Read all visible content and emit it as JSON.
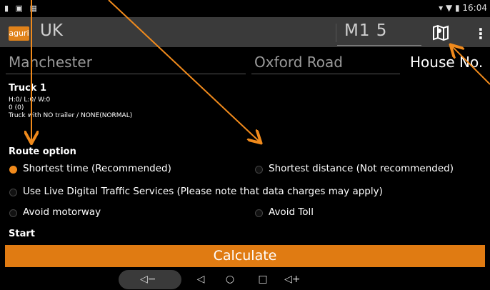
{
  "status": {
    "left_icons": "▮ ▣ ▦",
    "right": "▾ ▼ ▮ 16:04"
  },
  "topbar": {
    "logo": "aguri",
    "country": "UK",
    "postcode": "M1 5"
  },
  "address": {
    "city": "Manchester",
    "street": "Oxford Road",
    "house": "House No."
  },
  "truck": {
    "title": "Truck 1",
    "lines": [
      "H:0/ L:0/ W:0",
      "0 (0)",
      "Truck with NO trailer / NONE(NORMAL)"
    ]
  },
  "route": {
    "title": "Route option",
    "options": [
      {
        "label": "Shortest time (Recommended)",
        "selected": true
      },
      {
        "label": "Shortest distance (Not recommended)",
        "selected": false
      },
      {
        "label": "Use Live Digital Traffic Services (Please note that data charges may apply)",
        "selected": false
      },
      {
        "label": "Avoid motorway",
        "selected": false
      },
      {
        "label": "Avoid Toll",
        "selected": false
      }
    ]
  },
  "start_label": "Start",
  "calculate_label": "Calculate",
  "nav": {
    "vol_down": "◁−",
    "back": "◁",
    "home": "○",
    "recents": "□",
    "vol_up": "◁+"
  },
  "colors": {
    "accent": "#e07b12",
    "topbar": "#3a3a3a",
    "background": "#000000"
  }
}
